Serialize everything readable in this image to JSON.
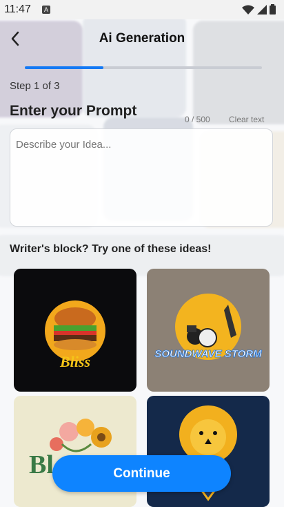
{
  "status": {
    "time": "11:47",
    "notif": "A"
  },
  "header": {
    "title": "Ai Generation"
  },
  "progress": {
    "value": 0.33
  },
  "step": "Step 1 of 3",
  "prompt": {
    "heading": "Enter your Prompt",
    "counter": "0 / 500",
    "clear_label": "Clear text",
    "placeholder": "Describe your Idea..."
  },
  "ideas": {
    "heading": "Writer's block? Try one of these ideas!",
    "cards": [
      {
        "label": "Bliss"
      },
      {
        "label": "SOUNDWAVE STORM"
      },
      {
        "label": "Bl"
      },
      {
        "label": ""
      }
    ]
  },
  "footer": {
    "continue_label": "Continue"
  }
}
